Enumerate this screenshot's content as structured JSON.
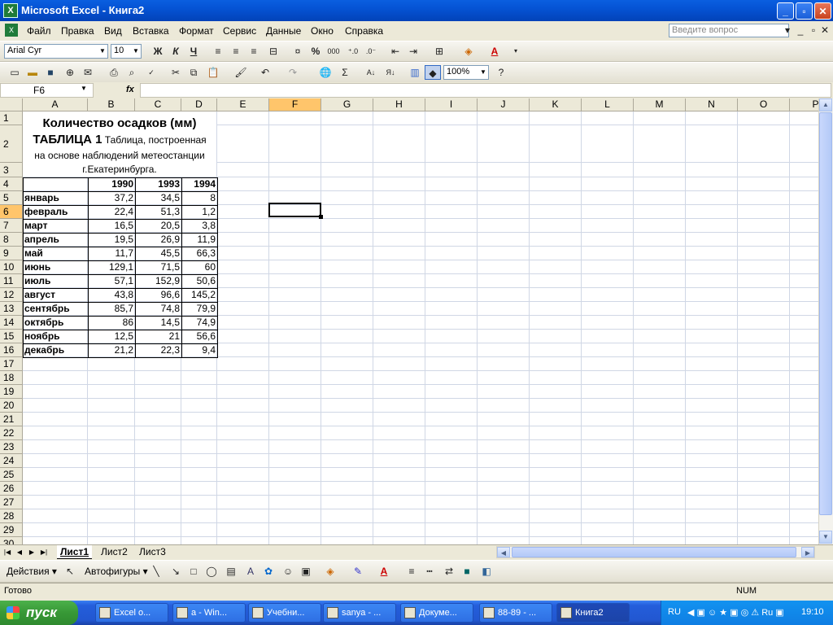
{
  "window": {
    "title": "Microsoft Excel - Книга2",
    "minimize": "_",
    "restore": "▫",
    "close": "✕"
  },
  "menu": {
    "items": [
      "Файл",
      "Правка",
      "Вид",
      "Вставка",
      "Формат",
      "Сервис",
      "Данные",
      "Окно",
      "Справка"
    ],
    "help_placeholder": "Введите вопрос"
  },
  "format_toolbar": {
    "font": "Arial Cyr",
    "size": "10",
    "bold": "Ж",
    "italic": "К",
    "underline": "Ч",
    "percent": "%",
    "thousands": "000"
  },
  "std_toolbar": {
    "zoom": "100%",
    "sum": "Σ"
  },
  "formula_bar": {
    "cell_ref": "F6",
    "fx": "fx",
    "value": ""
  },
  "grid": {
    "columns": [
      "A",
      "B",
      "C",
      "D",
      "E",
      "F",
      "G",
      "H",
      "I",
      "J",
      "K",
      "L",
      "M",
      "N",
      "O",
      "P"
    ],
    "rows": [
      "1",
      "2",
      "3",
      "4",
      "5",
      "6",
      "7",
      "8",
      "9",
      "10",
      "11",
      "12",
      "13",
      "14",
      "15",
      "16",
      "17",
      "18",
      "19",
      "20",
      "21",
      "22",
      "23",
      "24",
      "25",
      "26",
      "27",
      "28",
      "29",
      "30"
    ],
    "selected_cell": "F6"
  },
  "sheet": {
    "title": "Количество осадков (мм)",
    "table_label": "ТАБЛИЦА 1",
    "desc_1": "Таблица, построенная",
    "desc_2": "на основе наблюдений метеостанции",
    "desc_3": "г.Екатеринбурга.",
    "years": [
      "1990",
      "1993",
      "1994"
    ],
    "data": [
      {
        "month": "январь",
        "v1990": "37,2",
        "v1993": "34,5",
        "v1994": "8"
      },
      {
        "month": "февраль",
        "v1990": "22,4",
        "v1993": "51,3",
        "v1994": "1,2"
      },
      {
        "month": "март",
        "v1990": "16,5",
        "v1993": "20,5",
        "v1994": "3,8"
      },
      {
        "month": "апрель",
        "v1990": "19,5",
        "v1993": "26,9",
        "v1994": "11,9"
      },
      {
        "month": "май",
        "v1990": "11,7",
        "v1993": "45,5",
        "v1994": "66,3"
      },
      {
        "month": "июнь",
        "v1990": "129,1",
        "v1993": "71,5",
        "v1994": "60"
      },
      {
        "month": "июль",
        "v1990": "57,1",
        "v1993": "152,9",
        "v1994": "50,6"
      },
      {
        "month": "август",
        "v1990": "43,8",
        "v1993": "96,6",
        "v1994": "145,2"
      },
      {
        "month": "сентябрь",
        "v1990": "85,7",
        "v1993": "74,8",
        "v1994": "79,9"
      },
      {
        "month": "октябрь",
        "v1990": "86",
        "v1993": "14,5",
        "v1994": "74,9"
      },
      {
        "month": "ноябрь",
        "v1990": "12,5",
        "v1993": "21",
        "v1994": "56,6"
      },
      {
        "month": "декабрь",
        "v1990": "21,2",
        "v1993": "22,3",
        "v1994": "9,4"
      }
    ]
  },
  "sheet_tabs": [
    "Лист1",
    "Лист2",
    "Лист3"
  ],
  "active_sheet": "Лист1",
  "drawing_toolbar": {
    "actions": "Действия",
    "autoshapes": "Автофигуры"
  },
  "status": {
    "left": "Готово",
    "num": "NUM"
  },
  "taskbar": {
    "start": "пуск",
    "tasks": [
      "Excel о...",
      "a - Win...",
      "Учебни...",
      "sanya - ...",
      "Докуме...",
      "88-89 - ...",
      "Книга2"
    ],
    "active_task": "Книга2",
    "lang": "RU",
    "clock": "19:10"
  }
}
